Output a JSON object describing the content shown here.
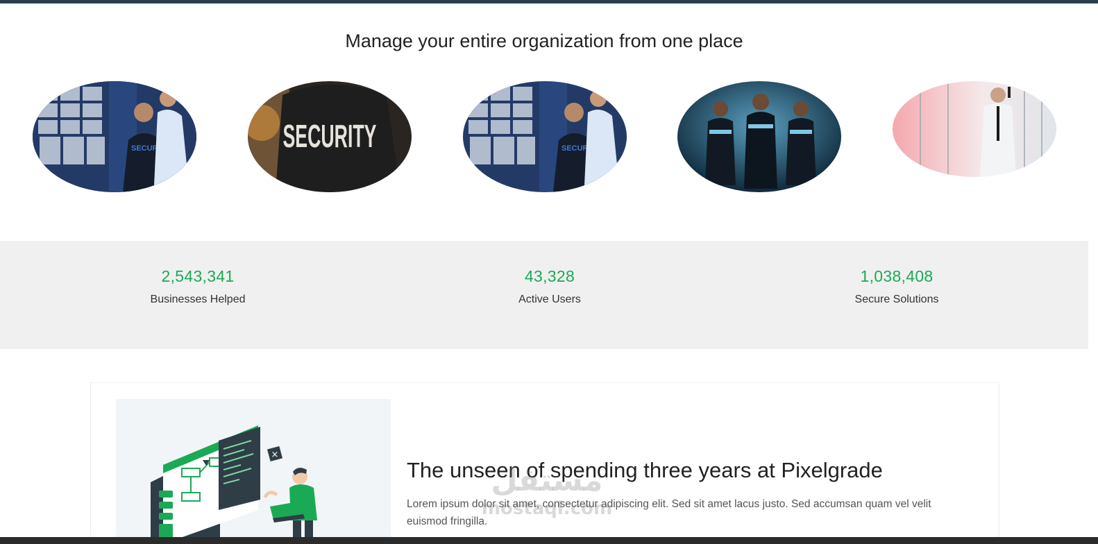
{
  "hero": {
    "title": "Manage your entire organization from one place"
  },
  "gallery": {
    "images": [
      {
        "subject": "control-room-officers"
      },
      {
        "subject": "security-jacket-back",
        "text": "SECURITY"
      },
      {
        "subject": "control-room-officers"
      },
      {
        "subject": "three-guards-night"
      },
      {
        "subject": "guard-with-radio"
      }
    ]
  },
  "stats": [
    {
      "value": "2,543,341",
      "label": "Businesses Helped"
    },
    {
      "value": "43,328",
      "label": "Active Users"
    },
    {
      "value": "1,038,408",
      "label": "Secure Solutions"
    }
  ],
  "article": {
    "title": "The unseen of spending three years at Pixelgrade",
    "body": "Lorem ipsum dolor sit amet, consectetur adipiscing elit. Sed sit amet lacus justo. Sed accumsan quam vel velit euismod fringilla."
  },
  "watermark": {
    "arabic": "مستقل",
    "latin": "mostaql.com"
  },
  "colors": {
    "accent": "#1aaa55",
    "topbar": "#2c3e50",
    "stats_bg": "#f0f0f0"
  }
}
